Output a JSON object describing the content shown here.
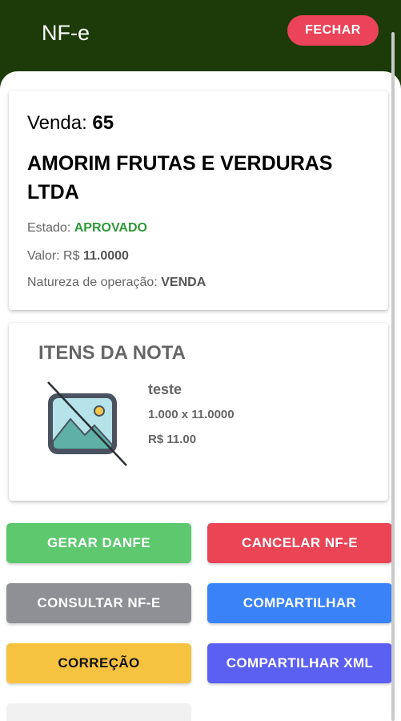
{
  "header": {
    "title": "NF-e",
    "close_label": "FECHAR"
  },
  "sale": {
    "venda_label": "Venda:",
    "venda_number": "65",
    "company": "AMORIM FRUTAS E VERDURAS LTDA",
    "status_label": "Estado:",
    "status_value": "APROVADO",
    "value_label": "Valor: R$",
    "value_value": "11.0000",
    "nature_label": "Natureza de operação:",
    "nature_value": "VENDA"
  },
  "items": {
    "title": "ITENS DA NOTA",
    "list": [
      {
        "name": "teste",
        "quantity_line": "1.000 x 11.0000",
        "total_line": "R$ 11.00",
        "image_icon": "no-image-icon"
      }
    ]
  },
  "actions": {
    "gerar_danfe": "GERAR DANFE",
    "cancelar": "CANCELAR NF-E",
    "consultar": "CONSULTAR NF-E",
    "compartilhar": "COMPARTILHAR",
    "correcao": "CORREÇÃO",
    "compartilhar_xml": "COMPARTILHAR XML"
  },
  "colors": {
    "header_bg": "#1c3b08",
    "approved": "#2f9b39",
    "danger": "#eb445a",
    "success": "#5dc86d",
    "medium": "#8e9096",
    "primary": "#3a82f7",
    "warning": "#f6c340",
    "tertiary": "#5b5ff2"
  }
}
